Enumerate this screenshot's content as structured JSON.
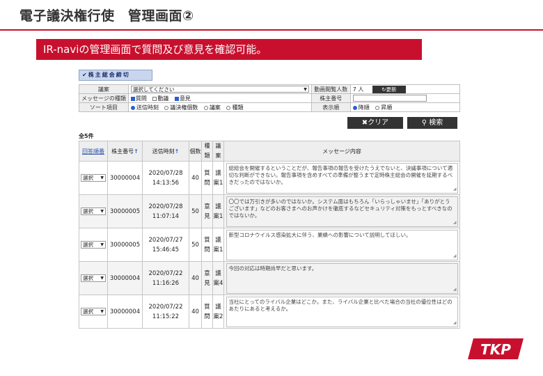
{
  "slide": {
    "title": "電子議決権行使　管理画面②",
    "banner": "IR-naviの管理画面で質問及び意見を確認可能。"
  },
  "colors": {
    "brand_red": "#c8102e",
    "button_dark": "#333333",
    "accent_blue": "#2b5fcf"
  },
  "app": {
    "close_button": "株主総会締切",
    "filters": {
      "agenda_label": "議案",
      "agenda_value": "選択してください",
      "viewers_label": "動画閲覧人数",
      "viewers_value": "7 人",
      "refresh_label": "更新",
      "msgtype_label": "メッセージの種類",
      "msgtype_options": [
        {
          "label": "質問",
          "checked": true
        },
        {
          "label": "動議",
          "checked": false
        },
        {
          "label": "意見",
          "checked": true
        }
      ],
      "shareholder_label": "株主番号",
      "shareholder_value": "",
      "sort_label": "ソート項目",
      "sort_options": [
        {
          "label": "送信時刻",
          "checked": true
        },
        {
          "label": "議決権個数",
          "checked": false
        },
        {
          "label": "議案",
          "checked": false
        },
        {
          "label": "種類",
          "checked": false
        }
      ],
      "order_label": "表示順",
      "order_options": [
        {
          "label": "降順",
          "checked": true
        },
        {
          "label": "昇順",
          "checked": false
        }
      ]
    },
    "clear_label": "クリア",
    "search_label": "検索",
    "count_text": "全5件",
    "table": {
      "headers": {
        "answer_order": "回答順番",
        "shareholder_no": "株主番号",
        "sent_time": "送信時刻",
        "count": "個数",
        "type_a": "種",
        "type_b": "類",
        "agenda_a": "議",
        "agenda_b": "案",
        "message": "メッセージ内容"
      },
      "rows": [
        {
          "select": "選択",
          "shareholder": "30000004",
          "date": "2020/07/28",
          "time": "14:13:56",
          "count": "40",
          "type_a": "質",
          "type_b": "問",
          "agenda_a": "議",
          "agenda_b": "案1",
          "message": "総総会を開催するということだが、報告事項の報告を受けたうえでないと、決議事項について適切な判断ができない。報告事項を含めすべての準備が整うまで定時株主総会の開催を延期するべきだったのではないか。"
        },
        {
          "select": "選択",
          "shareholder": "30000005",
          "date": "2020/07/28",
          "time": "11:07:14",
          "count": "50",
          "type_a": "意",
          "type_b": "見",
          "agenda_a": "議",
          "agenda_b": "案1",
          "message": "〇〇では万引きが多いのではないか。システム面はもちろん「いらっしゃいませ」「ありがとうございます」などのお客さまへのお声かけを徹底するなどセキュリティ対策をもっとすべきなのではないか。"
        },
        {
          "select": "選択",
          "shareholder": "30000005",
          "date": "2020/07/27",
          "time": "15:46:45",
          "count": "50",
          "type_a": "質",
          "type_b": "問",
          "agenda_a": "議",
          "agenda_b": "案1",
          "message": "新型コロナウイルス感染拡大に伴う、業績への影響について説明してほしい。"
        },
        {
          "select": "選択",
          "shareholder": "30000004",
          "date": "2020/07/22",
          "time": "11:16:26",
          "count": "40",
          "type_a": "意",
          "type_b": "見",
          "agenda_a": "議",
          "agenda_b": "案4",
          "message": "今回の対応は時期尚早だと思います。"
        },
        {
          "select": "選択",
          "shareholder": "30000004",
          "date": "2020/07/22",
          "time": "11:15:22",
          "count": "40",
          "type_a": "質",
          "type_b": "問",
          "agenda_a": "議",
          "agenda_b": "案2",
          "message": "当社にとってのライバル企業はどこか。また、ライバル企業と比べた場合の当社の優位性はどのあたりにあると考えるか。"
        }
      ]
    }
  },
  "logo_text": "TKP"
}
